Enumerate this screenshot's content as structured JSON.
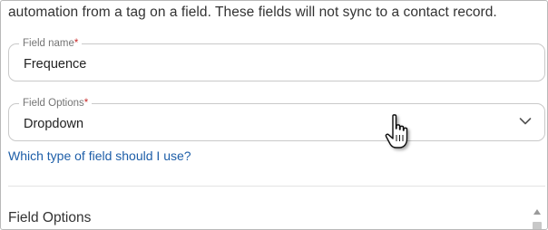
{
  "intro_text": "automation from a tag on a field. These fields will not sync to a contact record.",
  "field_name": {
    "label": "Field name",
    "required_mark": "*",
    "value": "Frequence"
  },
  "field_options": {
    "label": "Field Options",
    "required_mark": "*",
    "selected": "Dropdown"
  },
  "help_link": "Which type of field should I use?",
  "section_title": "Field Options",
  "colors": {
    "link": "#1d5ea8",
    "required": "#c62828",
    "border": "#c9c9c9"
  },
  "icons": [
    "chevron-down-icon",
    "hand-pointer-cursor-icon",
    "scroll-up-arrow-icon"
  ]
}
